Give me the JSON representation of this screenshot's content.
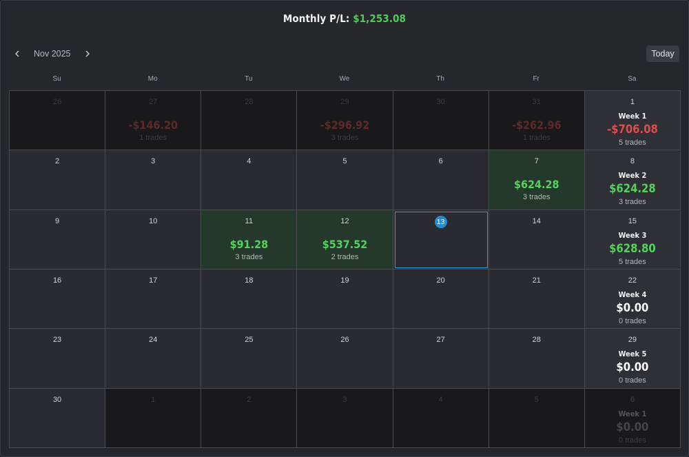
{
  "header": {
    "label": "Monthly P/L:",
    "value": "$1,253.08"
  },
  "nav": {
    "month": "Nov 2025",
    "prev_icon": "chevron-left-icon",
    "next_icon": "chevron-right-icon",
    "today_label": "Today"
  },
  "days_of_week": [
    "Su",
    "Mo",
    "Tu",
    "We",
    "Th",
    "Fr",
    "Sa"
  ],
  "colors": {
    "profit": "#53d35e",
    "loss": "#e04b4b",
    "today": "#1f8ddc"
  },
  "weeks": [
    {
      "days": [
        {
          "day": "26",
          "other": true
        },
        {
          "day": "27",
          "other": true,
          "pl": "-$146.20",
          "sign": "neg",
          "trades": "1 trades"
        },
        {
          "day": "28",
          "other": true
        },
        {
          "day": "29",
          "other": true,
          "pl": "-$296.92",
          "sign": "neg",
          "trades": "3 trades"
        },
        {
          "day": "30",
          "other": true
        },
        {
          "day": "31",
          "other": true,
          "pl": "-$262.96",
          "sign": "neg",
          "trades": "1 trades"
        }
      ],
      "summary": {
        "day": "1",
        "label": "Week 1",
        "pl": "-$706.08",
        "sign": "neg",
        "trades": "5 trades"
      }
    },
    {
      "days": [
        {
          "day": "2"
        },
        {
          "day": "3"
        },
        {
          "day": "4"
        },
        {
          "day": "5"
        },
        {
          "day": "6"
        },
        {
          "day": "7",
          "pl": "$624.28",
          "sign": "pos",
          "trades": "3 trades"
        }
      ],
      "summary": {
        "day": "8",
        "label": "Week 2",
        "pl": "$624.28",
        "sign": "pos",
        "trades": "3 trades"
      }
    },
    {
      "days": [
        {
          "day": "9"
        },
        {
          "day": "10"
        },
        {
          "day": "11",
          "pl": "$91.28",
          "sign": "pos",
          "trades": "3 trades"
        },
        {
          "day": "12",
          "pl": "$537.52",
          "sign": "pos",
          "trades": "2 trades"
        },
        {
          "day": "13",
          "today": true
        },
        {
          "day": "14"
        }
      ],
      "summary": {
        "day": "15",
        "label": "Week 3",
        "pl": "$628.80",
        "sign": "pos",
        "trades": "5 trades"
      }
    },
    {
      "days": [
        {
          "day": "16"
        },
        {
          "day": "17"
        },
        {
          "day": "18"
        },
        {
          "day": "19"
        },
        {
          "day": "20"
        },
        {
          "day": "21"
        }
      ],
      "summary": {
        "day": "22",
        "label": "Week 4",
        "pl": "$0.00",
        "sign": "zero",
        "trades": "0 trades"
      }
    },
    {
      "days": [
        {
          "day": "23"
        },
        {
          "day": "24"
        },
        {
          "day": "25"
        },
        {
          "day": "26"
        },
        {
          "day": "27"
        },
        {
          "day": "28"
        }
      ],
      "summary": {
        "day": "29",
        "label": "Week 5",
        "pl": "$0.00",
        "sign": "zero",
        "trades": "0 trades"
      }
    },
    {
      "days": [
        {
          "day": "30"
        },
        {
          "day": "1",
          "other": true
        },
        {
          "day": "2",
          "other": true
        },
        {
          "day": "3",
          "other": true
        },
        {
          "day": "4",
          "other": true
        },
        {
          "day": "5",
          "other": true
        }
      ],
      "summary": {
        "day": "6",
        "other": true,
        "label": "Week 1",
        "pl": "$0.00",
        "sign": "zero",
        "trades": "0 trades"
      }
    }
  ]
}
